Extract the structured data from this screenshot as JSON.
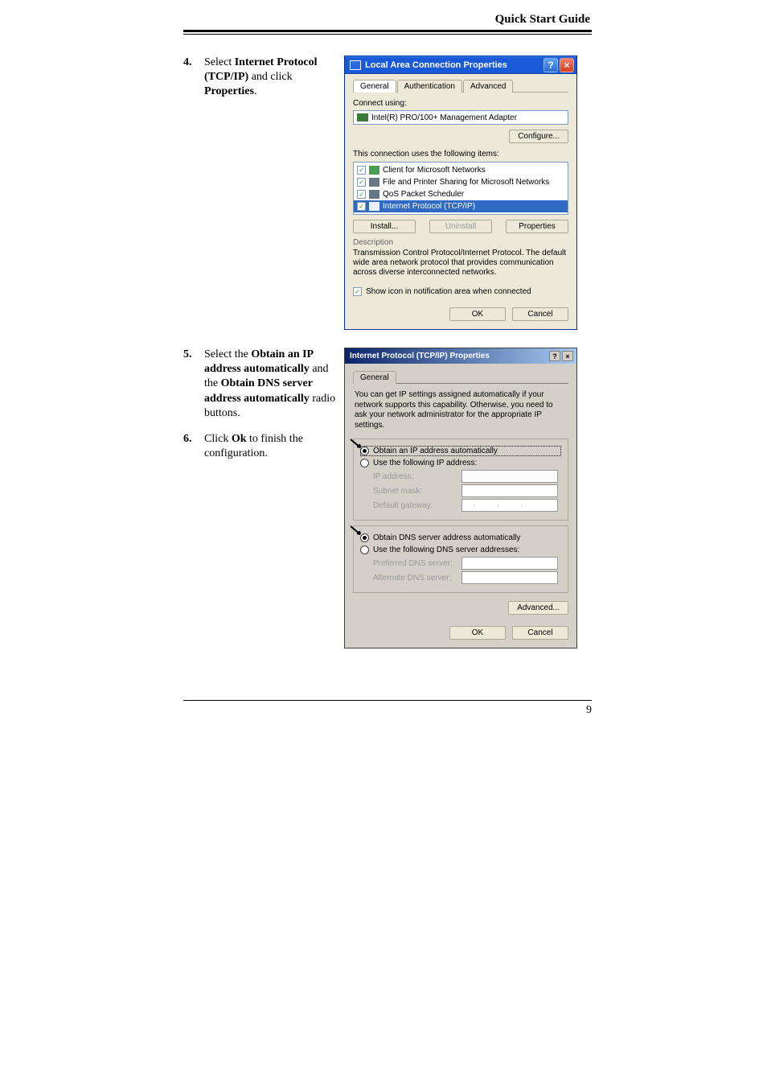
{
  "header": {
    "title": "Quick Start Guide"
  },
  "steps": [
    {
      "num": "4.",
      "parts": [
        {
          "t": "Select ",
          "b": false
        },
        {
          "t": "Internet Protocol (TCP/IP)",
          "b": true
        },
        {
          "t": " and click ",
          "b": false
        },
        {
          "t": "Properties",
          "b": true
        },
        {
          "t": ".",
          "b": false
        }
      ]
    },
    {
      "num": "5.",
      "parts": [
        {
          "t": "Select the ",
          "b": false
        },
        {
          "t": "Obtain an IP address automatically",
          "b": true
        },
        {
          "t": " and the ",
          "b": false
        },
        {
          "t": "Obtain DNS server address automatically",
          "b": true
        },
        {
          "t": " radio buttons.",
          "b": false
        }
      ]
    },
    {
      "num": "6.",
      "parts": [
        {
          "t": "Click ",
          "b": false
        },
        {
          "t": "Ok",
          "b": true
        },
        {
          "t": " to finish the configuration.",
          "b": false
        }
      ]
    }
  ],
  "dlg1": {
    "title": "Local Area Connection Properties",
    "tabs": [
      "General",
      "Authentication",
      "Advanced"
    ],
    "connect_label": "Connect using:",
    "adapter": "Intel(R) PRO/100+ Management Adapter",
    "configure": "Configure...",
    "uses_label": "This connection uses the following items:",
    "items": [
      "Client for Microsoft Networks",
      "File and Printer Sharing for Microsoft Networks",
      "QoS Packet Scheduler",
      "Internet Protocol (TCP/IP)"
    ],
    "install": "Install...",
    "uninstall": "Uninstall",
    "properties": "Properties",
    "desc_label": "Description",
    "desc": "Transmission Control Protocol/Internet Protocol. The default wide area network protocol that provides communication across diverse interconnected networks.",
    "showicon": "Show icon in notification area when connected",
    "ok": "OK",
    "cancel": "Cancel"
  },
  "dlg2": {
    "title": "Internet Protocol (TCP/IP) Properties",
    "tab": "General",
    "desc": "You can get IP settings assigned automatically if your network supports this capability. Otherwise, you need to ask your network administrator for the appropriate IP settings.",
    "r_obtain_ip": "Obtain an IP address automatically",
    "r_use_ip": "Use the following IP address:",
    "ip": "IP address:",
    "mask": "Subnet mask:",
    "gw": "Default gateway:",
    "r_obtain_dns": "Obtain DNS server address automatically",
    "r_use_dns": "Use the following DNS server addresses:",
    "pref": "Preferred DNS server:",
    "alt": "Alternate DNS server:",
    "advanced": "Advanced...",
    "ok": "OK",
    "cancel": "Cancel"
  },
  "page_number": "9"
}
